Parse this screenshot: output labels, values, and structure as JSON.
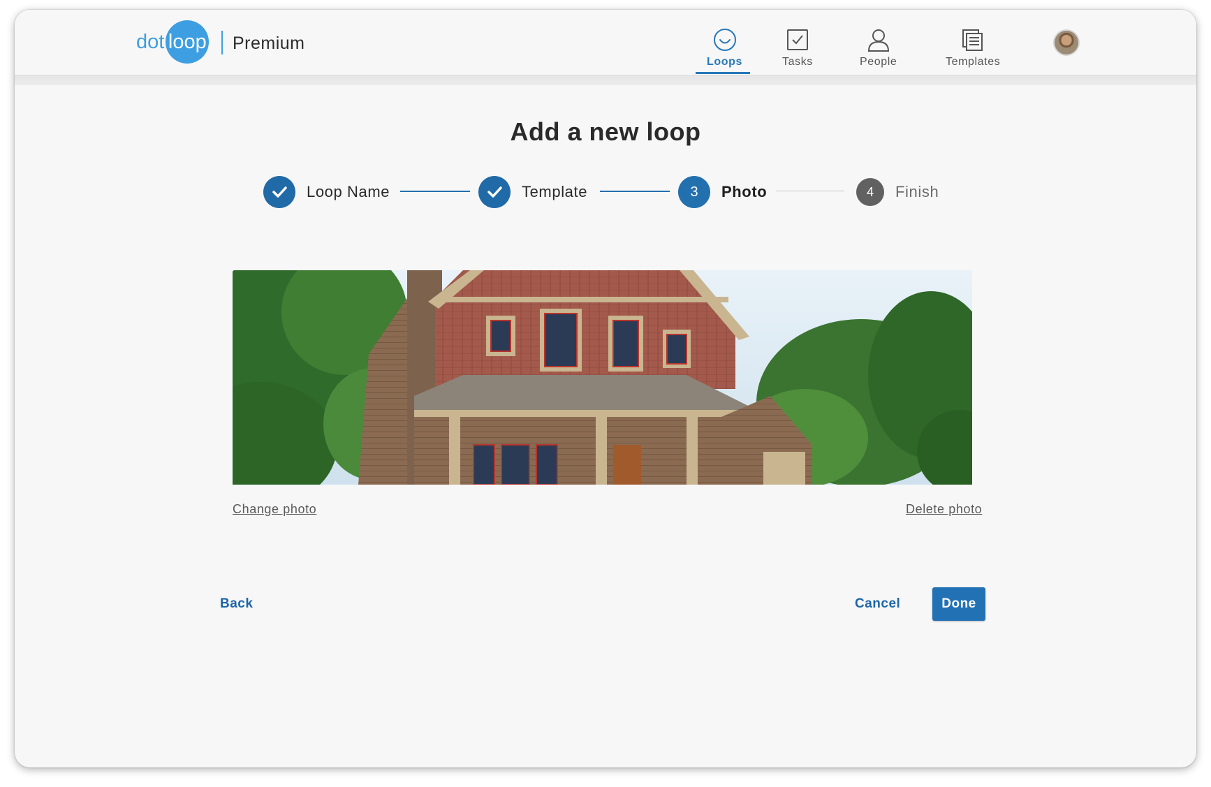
{
  "header": {
    "logo": {
      "prefix": "dot",
      "circle": "loop"
    },
    "product": "Premium",
    "nav": [
      {
        "label": "Loops",
        "icon": "smile-icon",
        "active": true
      },
      {
        "label": "Tasks",
        "icon": "checkbox-icon",
        "active": false
      },
      {
        "label": "People",
        "icon": "person-icon",
        "active": false
      },
      {
        "label": "Templates",
        "icon": "templates-icon",
        "active": false
      }
    ],
    "avatar": "user-avatar"
  },
  "page": {
    "title": "Add a new loop"
  },
  "stepper": {
    "steps": [
      {
        "label": "Loop Name",
        "state": "done",
        "marker": ""
      },
      {
        "label": "Template",
        "state": "done",
        "marker": ""
      },
      {
        "label": "Photo",
        "state": "current",
        "marker": "3"
      },
      {
        "label": "Finish",
        "state": "pending",
        "marker": "4"
      }
    ]
  },
  "photo": {
    "subject": "house-photo",
    "change_label": "Change photo",
    "delete_label": "Delete photo"
  },
  "actions": {
    "back": "Back",
    "cancel": "Cancel",
    "done": "Done"
  },
  "colors": {
    "brand": "#3d9fe1",
    "primary": "#2271b4",
    "step_done": "#1f6aa7",
    "step_pending": "#616161"
  }
}
